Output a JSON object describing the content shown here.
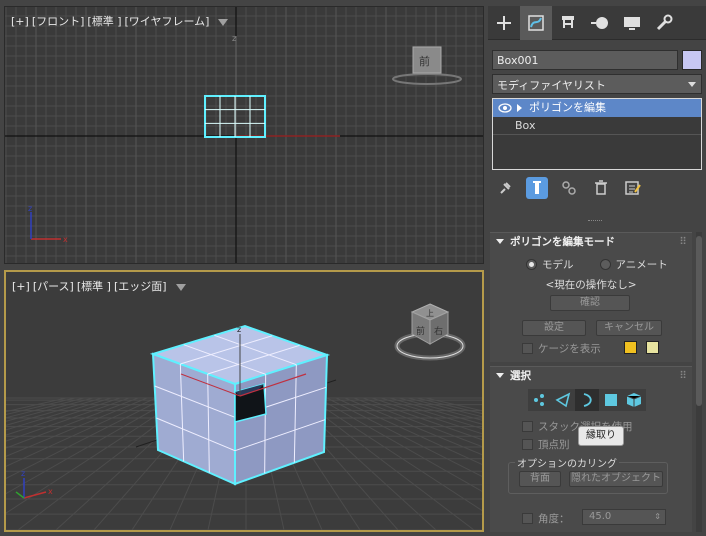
{
  "viewport_top": {
    "labels": [
      "[+]",
      "[フロント]",
      "[標準 ]",
      "[ワイヤフレーム]"
    ]
  },
  "viewport_persp": {
    "labels": [
      "[+]",
      "[パース]",
      "[標準 ]",
      "[エッジ面]"
    ]
  },
  "viewcube_top": {
    "face": "前"
  },
  "viewcube_persp": {
    "face_top": "上",
    "face_left": "前",
    "face_right": "右"
  },
  "axis": {
    "x": "x",
    "y": "y",
    "z": "z"
  },
  "panel": {
    "object_name": "Box001",
    "color": "#c8c8f4",
    "modifier_list": "モディファイヤリスト",
    "stack": [
      {
        "label": "ポリゴンを編集",
        "selected": true
      },
      {
        "label": "Box",
        "selected": false
      }
    ]
  },
  "rollout_mode": {
    "title": "ポリゴンを編集モード",
    "radio_model": "モデル",
    "radio_animate": "アニメート",
    "no_operation": "<現在の操作なし>",
    "confirm": "確認",
    "settings": "設定",
    "cancel": "キャンセル",
    "show_cage": "ケージを表示",
    "cage_colors": [
      "#f0c020",
      "#e8e4a0"
    ]
  },
  "rollout_select": {
    "title": "選択",
    "use_stack": "スタック選択を使用",
    "by_vertex": "頂点別",
    "tooltip": "縁取り",
    "culling_group": "オプションのカリング",
    "back_face": "背面",
    "hidden_objects": "隠れたオブジェクト",
    "angle_label": "角度：",
    "angle_value": "45.0"
  }
}
